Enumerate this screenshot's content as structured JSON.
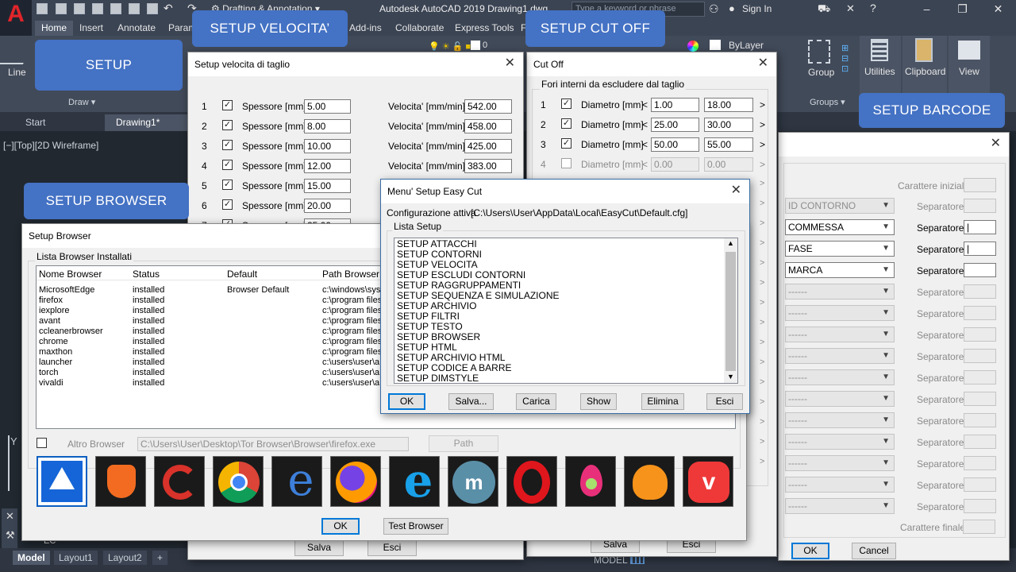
{
  "app": {
    "title": "Autodesk AutoCAD 2019   Drawing1.dwg",
    "workspace": "Drafting & Annotation",
    "search_placeholder": "Type a keyword or phrase",
    "signin": "Sign In",
    "ribbon_tabs": [
      "Home",
      "Insert",
      "Annotate",
      "Param",
      "Add-ins",
      "Collaborate",
      "Express Tools",
      "F"
    ],
    "ribbon": {
      "line": "Line",
      "draw": "Draw",
      "layer": "ByLayer",
      "layer_num": "0",
      "group": "Group",
      "groups": "Groups",
      "utilities": "Utilities",
      "clipboard": "Clipboard",
      "view": "View"
    },
    "file_tabs": [
      "Start",
      "Drawing1*"
    ],
    "viewport_label": "[−][Top][2D Wireframe]",
    "layout_tabs": [
      "Model",
      "Layout1",
      "Layout2",
      "+"
    ],
    "statusbar_model": "MODEL",
    "cmd_text": "EC"
  },
  "callouts": {
    "setup": "SETUP",
    "velocita": "SETUP VELOCITA’",
    "cutoff": "SETUP CUT OFF",
    "barcode": "SETUP BARCODE",
    "browser": "SETUP BROWSER"
  },
  "velocita": {
    "title": "Setup velocita di taglio",
    "spessore_label": "Spessore [mm]",
    "velocita_label": "Velocita' [mm/min]",
    "rows": [
      {
        "n": "1",
        "spessore": "5.00",
        "velocita": "542.00"
      },
      {
        "n": "2",
        "spessore": "8.00",
        "velocita": "458.00"
      },
      {
        "n": "3",
        "spessore": "10.00",
        "velocita": "425.00"
      },
      {
        "n": "4",
        "spessore": "12.00",
        "velocita": "383.00"
      },
      {
        "n": "5",
        "spessore": "15.00",
        "velocita": ""
      },
      {
        "n": "6",
        "spessore": "20.00",
        "velocita": ""
      },
      {
        "n": "7",
        "spessore": "25.00",
        "velocita": ""
      }
    ],
    "save": "Salva",
    "exit": "Esci"
  },
  "cutoff": {
    "title": "Cut Off",
    "group": "Fori interni da escludere dal taglio",
    "diam_label": "Diametro [mm]",
    "rows": [
      {
        "n": "1",
        "min": "1.00",
        "max": "18.00"
      },
      {
        "n": "2",
        "min": "25.00",
        "max": "30.00"
      },
      {
        "n": "3",
        "min": "50.00",
        "max": "55.00"
      },
      {
        "n": "4",
        "min": "0.00",
        "max": "0.00"
      }
    ],
    "lt": "<",
    "gt": ">",
    "save": "Salva",
    "exit": "Esci"
  },
  "barcode": {
    "start_char": "Carattere iniziale",
    "end_char": "Carattere finale",
    "sep": "Separatore",
    "selects": [
      "ID CONTORNO",
      "COMMESSA",
      "FASE",
      "MARCA"
    ],
    "blank": "------",
    "ok": "OK",
    "cancel": "Cancel"
  },
  "easycut": {
    "title": "Menu' Setup Easy Cut",
    "config_label": "Configurazione attiva",
    "config_path": "[C:\\Users\\User\\AppData\\Local\\EasyCut\\Default.cfg]",
    "list_title": "Lista Setup",
    "items": [
      "SETUP ATTACCHI",
      "SETUP CONTORNI",
      "SETUP VELOCITA",
      "SETUP ESCLUDI CONTORNI",
      "SETUP RAGGRUPPAMENTI",
      "SETUP SEQUENZA E SIMULAZIONE",
      "SETUP ARCHIVIO",
      "SETUP FILTRI",
      "SETUP TESTO",
      "SETUP BROWSER",
      "SETUP HTML",
      "SETUP ARCHIVIO HTML",
      "SETUP CODICE A BARRE",
      "SETUP DIMSTYLE"
    ],
    "buttons": [
      "OK",
      "Salva...",
      "Carica",
      "Show",
      "Elimina",
      "Esci"
    ]
  },
  "browser": {
    "title": "Setup Browser",
    "group": "Lista Browser Installati",
    "columns": [
      "Nome Browser",
      "Status",
      "Default",
      "Path Browser"
    ],
    "rows": [
      {
        "name": "MicrosoftEdge",
        "status": "installed",
        "def": "Browser Default",
        "path": "c:\\windows\\sys"
      },
      {
        "name": "firefox",
        "status": "installed",
        "def": "",
        "path": "c:\\program files"
      },
      {
        "name": "iexplore",
        "status": "installed",
        "def": "",
        "path": "c:\\program files"
      },
      {
        "name": "avant",
        "status": "installed",
        "def": "",
        "path": "c:\\program files"
      },
      {
        "name": "ccleanerbrowser",
        "status": "installed",
        "def": "",
        "path": "c:\\program files"
      },
      {
        "name": "chrome",
        "status": "installed",
        "def": "",
        "path": "c:\\program files"
      },
      {
        "name": "maxthon",
        "status": "installed",
        "def": "",
        "path": "c:\\program files"
      },
      {
        "name": "launcher",
        "status": "installed",
        "def": "",
        "path": "c:\\users\\user\\a"
      },
      {
        "name": "torch",
        "status": "installed",
        "def": "",
        "path": "c:\\users\\user\\a"
      },
      {
        "name": "vivaldi",
        "status": "installed",
        "def": "",
        "path": "c:\\users\\user\\a"
      }
    ],
    "altro": "Altro Browser",
    "altro_path": "C:\\Users\\User\\Desktop\\Tor Browser\\Browser\\firefox.exe",
    "path_btn": "Path",
    "ok": "OK",
    "test": "Test Browser",
    "icons": [
      "avant-icon",
      "brave-icon",
      "ccleaner-icon",
      "chrome-icon",
      "edge-icon",
      "firefox-icon",
      "iexplore-icon",
      "maxthon-icon",
      "opera-icon",
      "torch-icon",
      "uc-icon",
      "vivaldi-icon"
    ]
  }
}
